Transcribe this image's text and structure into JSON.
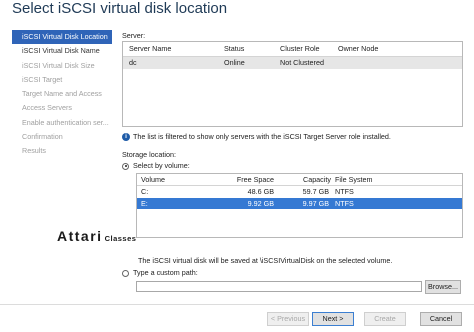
{
  "title": "Select iSCSI virtual disk location",
  "nav": [
    {
      "label": "iSCSI Virtual Disk Location",
      "state": "active"
    },
    {
      "label": "iSCSI Virtual Disk Name",
      "state": "done"
    },
    {
      "label": "iSCSI Virtual Disk Size",
      "state": "disabled"
    },
    {
      "label": "iSCSI Target",
      "state": "disabled"
    },
    {
      "label": "Target Name and Access",
      "state": "disabled"
    },
    {
      "label": "Access Servers",
      "state": "disabled"
    },
    {
      "label": "Enable authentication ser...",
      "state": "disabled"
    },
    {
      "label": "Confirmation",
      "state": "disabled"
    },
    {
      "label": "Results",
      "state": "disabled"
    }
  ],
  "server": {
    "label": "Server:",
    "columns": [
      "Server Name",
      "Status",
      "Cluster Role",
      "Owner Node"
    ],
    "rows": [
      [
        "dc",
        "Online",
        "Not Clustered",
        ""
      ]
    ]
  },
  "info_text": "The list is filtered to show only servers with the iSCSI Target Server role installed.",
  "storage": {
    "label": "Storage location:",
    "by_volume_label": "Select by volume:",
    "columns": [
      "Volume",
      "Free Space",
      "Capacity",
      "File System"
    ],
    "rows": [
      [
        "C:",
        "48.6 GB",
        "59.7 GB",
        "NTFS"
      ],
      [
        "E:",
        "9.92 GB",
        "9.97 GB",
        "NTFS"
      ]
    ],
    "selected_row": 1,
    "saved_note": "The iSCSI virtual disk will be saved at \\iSCSIVirtualDisk on the selected volume.",
    "custom_path_label": "Type a custom path:",
    "custom_path_value": ""
  },
  "watermark": {
    "big": "Attari",
    "small": "Classes"
  },
  "buttons": {
    "browse": "Browse...",
    "previous": "< Previous",
    "next": "Next >",
    "create": "Create",
    "cancel": "Cancel"
  }
}
